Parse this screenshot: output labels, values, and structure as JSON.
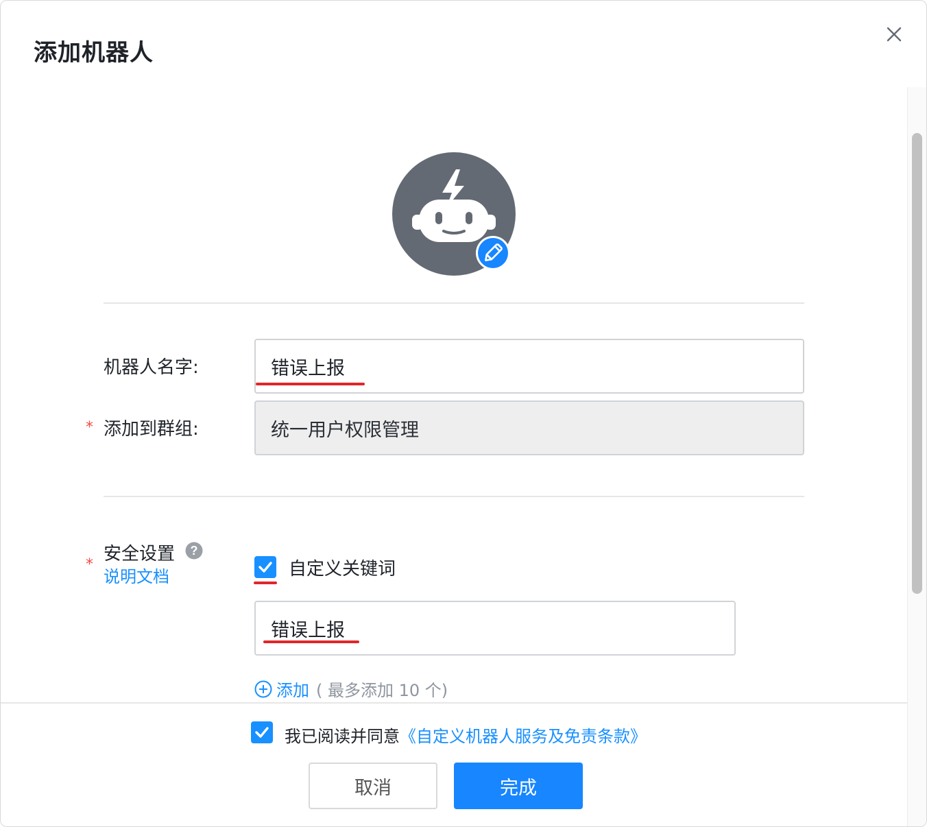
{
  "dialog": {
    "title": "添加机器人"
  },
  "robot_name": {
    "label": "机器人名字:",
    "value": "错误上报"
  },
  "group": {
    "required_mark": "*",
    "label": "添加到群组:",
    "value": "统一用户权限管理"
  },
  "security": {
    "required_mark": "*",
    "label": "安全设置",
    "doc_link": "说明文档",
    "keyword_option_label": "自定义关键词",
    "keyword_option_checked": true,
    "keyword_value": "错误上报",
    "add_label": "添加",
    "add_hint": "( 最多添加 10 个)"
  },
  "footer": {
    "agree_checked": true,
    "agree_prefix": "我已阅读并同意",
    "agree_link": "《自定义机器人服务及免责条款》",
    "cancel_label": "取消",
    "done_label": "完成"
  },
  "colors": {
    "primary": "#1786ff",
    "required": "#f54a45",
    "annotation_underline": "#e0262a",
    "avatar_bg": "#646a73"
  }
}
